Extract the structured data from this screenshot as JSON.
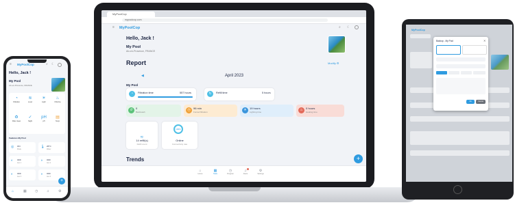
{
  "colors": {
    "accent": "#2f9be0",
    "text": "#1a2340",
    "filtration": "#4ec0e6",
    "orange": "#f0a23a",
    "blue": "#3a95dc",
    "green": "#5cc27a",
    "red": "#e36a5a"
  },
  "laptop": {
    "browser_tab": "MyPoolCop",
    "url": "mypoolcop.com",
    "app_title": "MyPoolCop",
    "greeting": "Hello, Jack !",
    "pool_name": "My Pool",
    "pool_address": "Aix-en-Provence, FRANCE",
    "report_title": "Report",
    "modify_link": "Modify ⚙",
    "month": "April 2023",
    "section_pool": "My Pool",
    "filtration": {
      "label": "Filtration time",
      "value": "557 hours"
    },
    "refill": {
      "label": "Refill time",
      "value": "5 hours"
    },
    "stats": [
      {
        "value": "0",
        "caption": "Backwash",
        "color": "#5cc27a"
      },
      {
        "value": "96 min",
        "caption": "Forced filtration",
        "color": "#f0a23a"
      },
      {
        "value": "19 hours",
        "caption": "Lighting time",
        "color": "#3a95dc"
      },
      {
        "value": "0 hours",
        "caption": "Heating time",
        "color": "#e36a5a"
      }
    ],
    "refills_card": {
      "value": "14 refill(s)",
      "caption": "Refill count"
    },
    "online_card": {
      "ring": "100%",
      "value": "Online",
      "caption": "Connectivity rate"
    },
    "trends_title": "Trends",
    "fab": "+",
    "nav": [
      {
        "icon": "⌂",
        "label": "Home"
      },
      {
        "icon": "▦",
        "label": "Stats"
      },
      {
        "icon": "◷",
        "label": "Program"
      },
      {
        "icon": "♫",
        "label": "Alerts"
      },
      {
        "icon": "⚙",
        "label": "Settings"
      }
    ]
  },
  "phone": {
    "app_title": "MyPoolCop",
    "greeting": "Hello, Jack !",
    "pool_name": "My Pool",
    "pool_address": "Aix-en-Provence, FRANCE",
    "controls": [
      {
        "icon": "◔",
        "label": "Filtration"
      },
      {
        "icon": "≋",
        "label": "Level"
      },
      {
        "icon": "☀",
        "label": "Light"
      },
      {
        "icon": "♨",
        "label": "Chlorine"
      },
      {
        "icon": "♻",
        "label": "Filter clean"
      },
      {
        "icon": "✓",
        "label": "Night"
      },
      {
        "icon": "pH",
        "label": "pH"
      },
      {
        "icon": "▤",
        "label": "Temp"
      }
    ],
    "features_title": "Features My Pool",
    "features": [
      {
        "icon": "◎",
        "value": "ON",
        "caption": "Mode"
      },
      {
        "icon": "🌡",
        "value": "26°C",
        "caption": "Water"
      },
      {
        "icon": "◐",
        "value": "OFF",
        "caption": "Aux 1"
      },
      {
        "icon": "◑",
        "value": "OFF",
        "caption": "Aux 2"
      },
      {
        "icon": "◐",
        "value": "OFF",
        "caption": "Aux 3"
      },
      {
        "icon": "◑",
        "value": "OFF",
        "caption": "Aux 4"
      }
    ],
    "fab": "+",
    "nav": [
      "⌂",
      "▦",
      "◷",
      "♫",
      "⚙"
    ]
  },
  "tablet": {
    "app_title": "MyPoolCop",
    "modal_title": "Backup - My Pool",
    "modal_close": "✕",
    "confirm_label": "Ok",
    "cancel_label": "Cancel"
  }
}
